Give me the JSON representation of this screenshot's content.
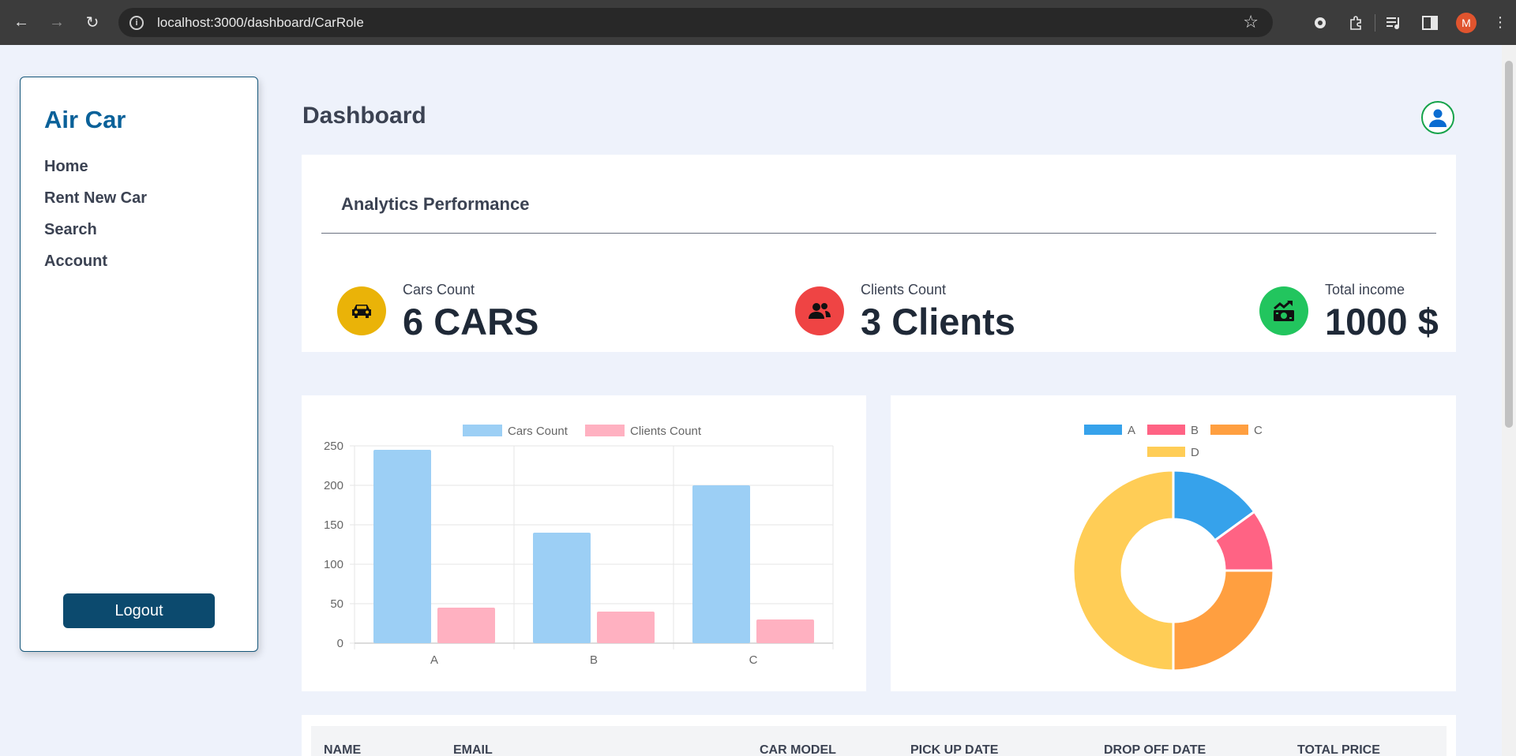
{
  "browser": {
    "url": "localhost:3000/dashboard/CarRole",
    "profile_initial": "M"
  },
  "sidebar": {
    "brand": "Air Car",
    "items": [
      {
        "label": "Home"
      },
      {
        "label": "Rent New Car"
      },
      {
        "label": "Search"
      },
      {
        "label": "Account"
      }
    ],
    "logout_label": "Logout"
  },
  "header": {
    "title": "Dashboard"
  },
  "analytics": {
    "heading": "Analytics Performance",
    "stats": [
      {
        "label": "Cars Count",
        "value": "6 CARS",
        "icon": "car-icon",
        "color": "#eab308"
      },
      {
        "label": "Clients Count",
        "value": "3 Clients",
        "icon": "users-icon",
        "color": "#ef4444"
      },
      {
        "label": "Total income",
        "value": "1000 $",
        "icon": "money-icon",
        "color": "#22c55e"
      }
    ]
  },
  "chart_data": [
    {
      "type": "bar",
      "categories": [
        "A",
        "B",
        "C"
      ],
      "series": [
        {
          "name": "Cars Count",
          "values": [
            245,
            140,
            200
          ],
          "color": "#9ccff5"
        },
        {
          "name": "Clients Count",
          "values": [
            45,
            40,
            30
          ],
          "color": "#ffb1c1"
        }
      ],
      "ylim": [
        0,
        250
      ],
      "yticks": [
        0,
        50,
        100,
        150,
        200,
        250
      ],
      "grid": true,
      "legend": "top"
    },
    {
      "type": "pie",
      "donut": true,
      "labels": [
        "A",
        "B",
        "C",
        "D"
      ],
      "values": [
        15,
        10,
        25,
        50
      ],
      "colors": [
        "#36a2eb",
        "#ff6384",
        "#ff9f40",
        "#ffcd56"
      ],
      "legend": "top"
    }
  ],
  "table": {
    "columns": [
      "NAME",
      "EMAIL",
      "CAR MODEL",
      "PICK UP DATE",
      "DROP OFF DATE",
      "TOTAL PRICE"
    ]
  }
}
